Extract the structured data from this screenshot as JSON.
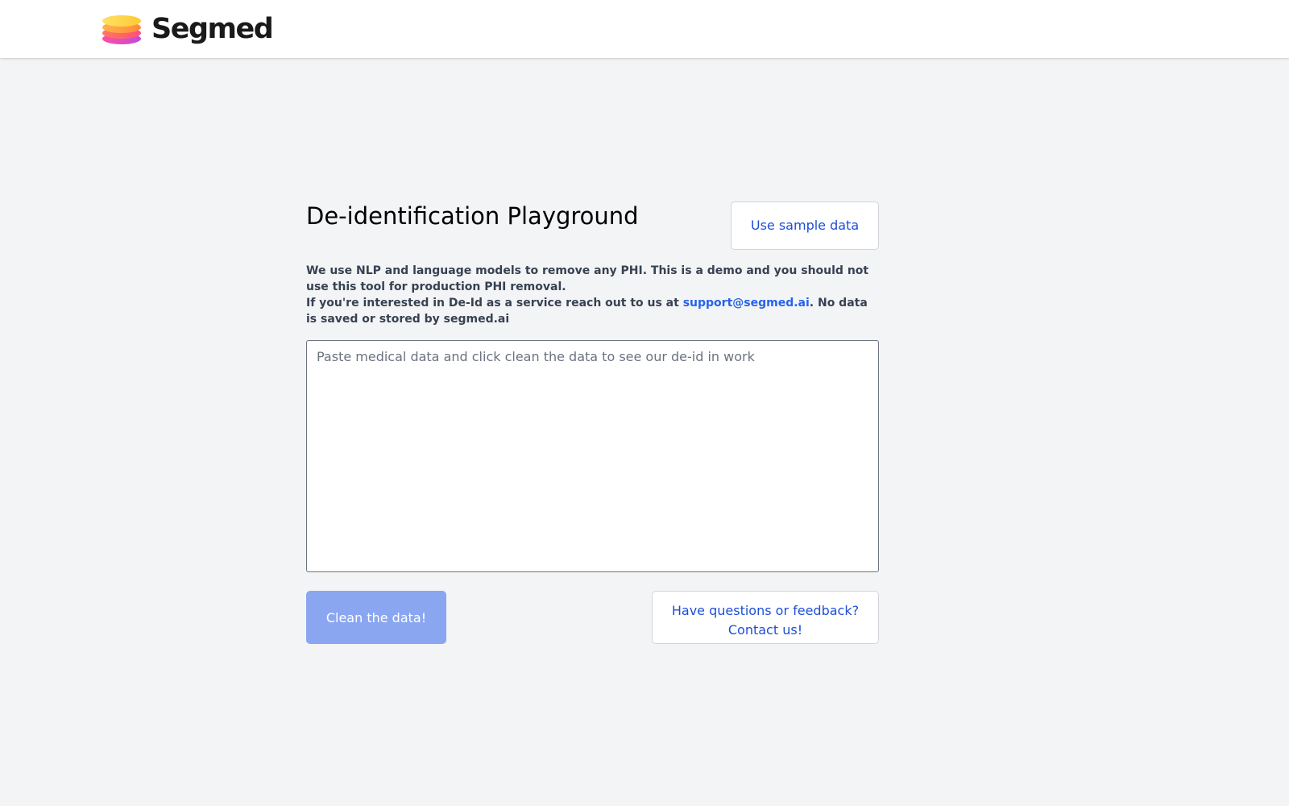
{
  "header": {
    "brand": "Segmed"
  },
  "main": {
    "title": "De-identification Playground",
    "sample_button": "Use sample data",
    "description_line1": "We use NLP and language models to remove any PHI. This is a demo and you should not use this tool for production PHI removal.",
    "description_line2_prefix": "If you're interested in De-Id as a service reach out to us at ",
    "support_email": "support@segmed.ai",
    "description_line2_suffix": ". No data is saved or stored by segmed.ai",
    "textarea_placeholder": "Paste medical data and click clean the data to see our de-id in work",
    "clean_button": "Clean the data!",
    "contact_line1": "Have questions or feedback?",
    "contact_line2": "Contact us!"
  },
  "colors": {
    "accent": "#1d4ed8",
    "link": "#2563eb",
    "clean_button_bg": "#8aa6f0",
    "page_bg": "#f3f4f6"
  }
}
